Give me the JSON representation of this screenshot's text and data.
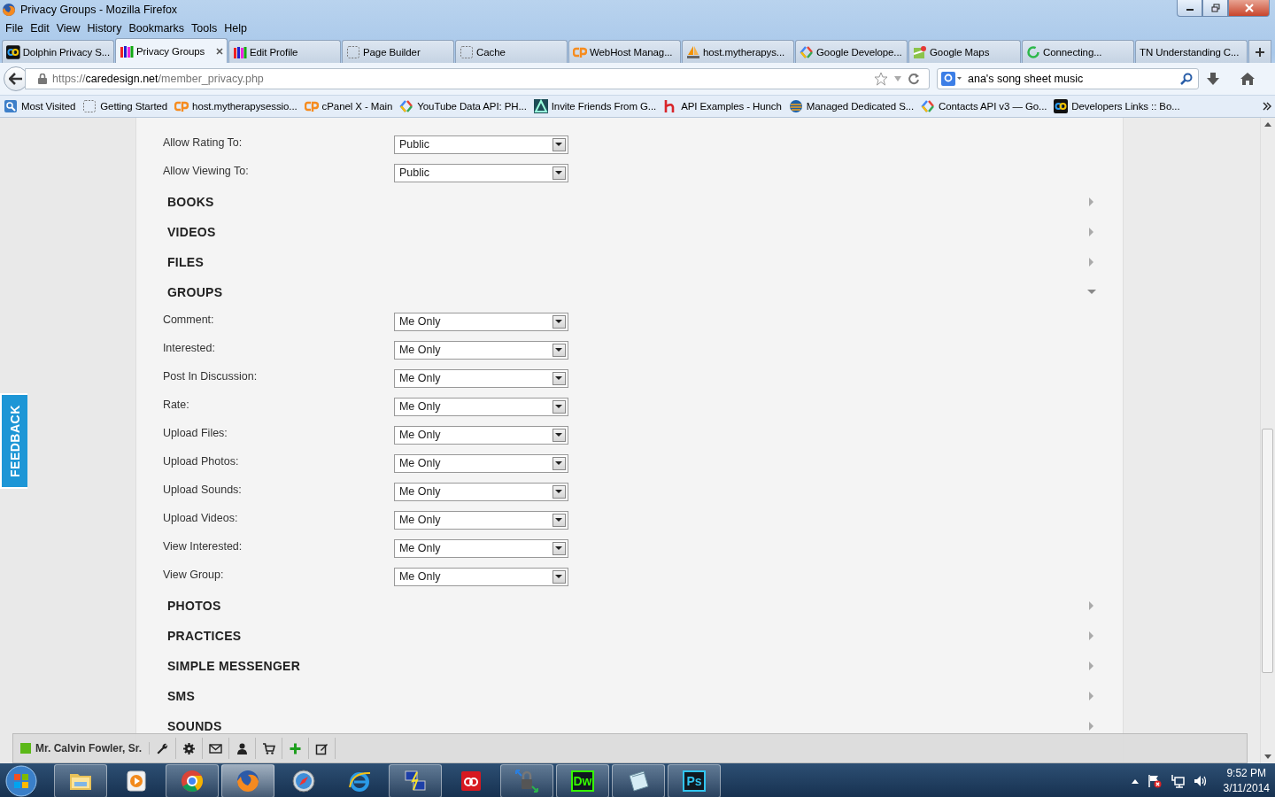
{
  "window": {
    "title": "Privacy Groups - Mozilla Firefox"
  },
  "menu": [
    "File",
    "Edit",
    "View",
    "History",
    "Bookmarks",
    "Tools",
    "Help"
  ],
  "tabs": [
    {
      "label": "Dolphin Privacy S...",
      "kind": "dolphin",
      "selected": false
    },
    {
      "label": "Privacy Groups",
      "kind": "people",
      "selected": true
    },
    {
      "label": "Edit Profile",
      "kind": "people",
      "selected": false
    },
    {
      "label": "Page Builder",
      "kind": "blank",
      "selected": false
    },
    {
      "label": "Cache",
      "kind": "blank",
      "selected": false
    },
    {
      "label": "WebHost Manag...",
      "kind": "cpanel",
      "selected": false
    },
    {
      "label": "host.mytherapys...",
      "kind": "pma",
      "selected": false
    },
    {
      "label": "Google Develope...",
      "kind": "google",
      "selected": false
    },
    {
      "label": "Google Maps",
      "kind": "maps",
      "selected": false
    },
    {
      "label": "Connecting...",
      "kind": "loading",
      "selected": false
    },
    {
      "label": "TN Understanding C...",
      "kind": "plain",
      "selected": false
    }
  ],
  "address": {
    "scheme": "https://",
    "host": "caredesign.net",
    "path": "/member_privacy.php"
  },
  "search": {
    "value": "ana's song sheet music"
  },
  "bookmarks": [
    {
      "label": "Most Visited",
      "kind": "mostvisited"
    },
    {
      "label": "Getting Started",
      "kind": "blank"
    },
    {
      "label": "host.mytherapysessio...",
      "kind": "cpanel"
    },
    {
      "label": "cPanel X - Main",
      "kind": "cpanel"
    },
    {
      "label": "YouTube Data API: PH...",
      "kind": "google"
    },
    {
      "label": "Invite Friends From G...",
      "kind": "atlassian"
    },
    {
      "label": "API Examples - Hunch",
      "kind": "hunch"
    },
    {
      "label": "Managed Dedicated S...",
      "kind": "managed"
    },
    {
      "label": "Contacts API v3 — Go...",
      "kind": "google"
    },
    {
      "label": "Developers Links :: Bo...",
      "kind": "dolphin"
    }
  ],
  "privacy": [
    {
      "kind": "field",
      "label": "Allow Rating To:",
      "value": "Public"
    },
    {
      "kind": "field",
      "label": "Allow Viewing To:",
      "value": "Public"
    },
    {
      "kind": "section",
      "title": "BOOKS",
      "expanded": false
    },
    {
      "kind": "section",
      "title": "VIDEOS",
      "expanded": false
    },
    {
      "kind": "section",
      "title": "FILES",
      "expanded": false
    },
    {
      "kind": "section",
      "title": "GROUPS",
      "expanded": true
    },
    {
      "kind": "field",
      "label": "Comment:",
      "value": "Me Only"
    },
    {
      "kind": "field",
      "label": "Interested:",
      "value": "Me Only"
    },
    {
      "kind": "field",
      "label": "Post In Discussion:",
      "value": "Me Only"
    },
    {
      "kind": "field",
      "label": "Rate:",
      "value": "Me Only"
    },
    {
      "kind": "field",
      "label": "Upload Files:",
      "value": "Me Only"
    },
    {
      "kind": "field",
      "label": "Upload Photos:",
      "value": "Me Only"
    },
    {
      "kind": "field",
      "label": "Upload Sounds:",
      "value": "Me Only"
    },
    {
      "kind": "field",
      "label": "Upload Videos:",
      "value": "Me Only"
    },
    {
      "kind": "field",
      "label": "View Interested:",
      "value": "Me Only"
    },
    {
      "kind": "field",
      "label": "View Group:",
      "value": "Me Only"
    },
    {
      "kind": "section",
      "title": "PHOTOS",
      "expanded": false
    },
    {
      "kind": "section",
      "title": "PRACTICES",
      "expanded": false
    },
    {
      "kind": "section",
      "title": "SIMPLE MESSENGER",
      "expanded": false
    },
    {
      "kind": "section",
      "title": "SMS",
      "expanded": false
    },
    {
      "kind": "section",
      "title": "SOUNDS",
      "expanded": false
    }
  ],
  "feedback": "FEEDBACK",
  "user_bar": {
    "name": "Mr. Calvin Fowler, Sr.",
    "online": true
  },
  "taskbar": {
    "apps": [
      {
        "kind": "explorer",
        "open": true,
        "active": false
      },
      {
        "kind": "media",
        "open": false,
        "active": false
      },
      {
        "kind": "chrome",
        "open": true,
        "active": false
      },
      {
        "kind": "firefox",
        "open": true,
        "active": true
      },
      {
        "kind": "safari",
        "open": false,
        "active": false
      },
      {
        "kind": "ie",
        "open": false,
        "active": false
      },
      {
        "kind": "putty",
        "open": true,
        "active": false
      },
      {
        "kind": "cloud",
        "open": false,
        "active": false
      },
      {
        "kind": "vpn",
        "open": true,
        "active": false
      },
      {
        "kind": "dreamweaver",
        "label": "Dw",
        "open": true,
        "active": false
      },
      {
        "kind": "notepad",
        "open": true,
        "active": false
      },
      {
        "kind": "photoshop",
        "label": "Ps",
        "open": true,
        "active": false
      }
    ],
    "time": "9:52 PM",
    "date": "3/11/2014"
  }
}
